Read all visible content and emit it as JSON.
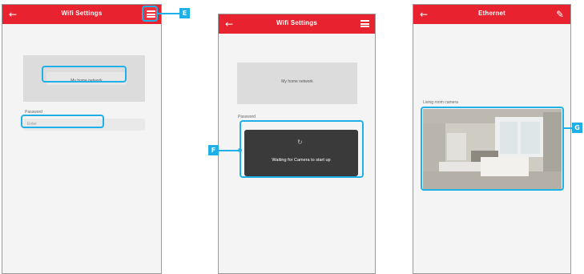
{
  "screens": [
    {
      "title": "Wifi Settings",
      "back_icon": "back-arrow-icon",
      "menu_icon": "menu-icon",
      "network_button": "My home network",
      "password_label": "Password",
      "password_placeholder": "Enter"
    },
    {
      "title": "Wifi Settings",
      "back_icon": "back-arrow-icon",
      "menu_icon": "menu-icon",
      "network_button": "My home network",
      "password_label": "Password",
      "toast_text": "Waiting for Camera to start up"
    },
    {
      "title": "Ethernet",
      "back_icon": "back-arrow-icon",
      "edit_icon": "pencil-icon",
      "camera_label": "Living room camera"
    }
  ],
  "callouts": {
    "e": "E",
    "f": "F",
    "g": "G"
  },
  "colors": {
    "header_red": "#e8232f",
    "callout_blue": "#1fb0e8"
  }
}
